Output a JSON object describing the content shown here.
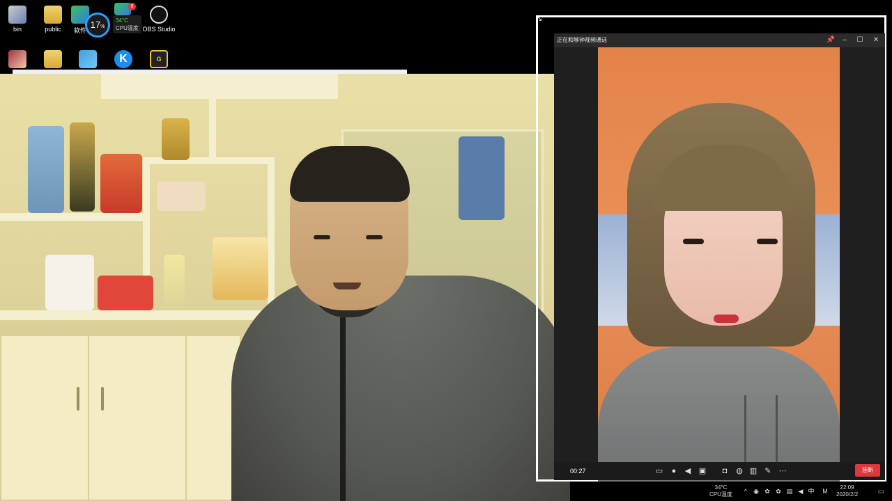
{
  "desktop": {
    "icons": [
      {
        "label": "bin",
        "icon": "recycle-bin-icon"
      },
      {
        "label": "public",
        "icon": "folder-icon"
      },
      {
        "label": "软件",
        "icon": "software-icon"
      },
      {
        "label": "OBS Studio",
        "icon": "obs-icon"
      }
    ],
    "row2_icons": [
      "game-avatar-icon",
      "folder-icon",
      "bird-app-icon",
      "kugou-icon",
      "g-app-icon"
    ],
    "cpu_widget": {
      "usage": "17",
      "usage_unit": "%",
      "temp": "34°C",
      "label": "CPU温度"
    },
    "badge": "8"
  },
  "call": {
    "title": "正在和够钟视频通话",
    "timer": "00:27",
    "hangup_label": "挂断",
    "controls": [
      "chat-icon",
      "mic-icon",
      "speaker-icon",
      "camera-icon",
      "snapshot-icon",
      "record-icon",
      "layout-icon",
      "edit-icon",
      "more-icon"
    ]
  },
  "taskbar": {
    "cpu_temp": "34°C",
    "cpu_label": "CPU温度",
    "ime": "中",
    "ime_mode": "M",
    "time": "22:09",
    "date": "2020/2/2"
  },
  "colors": {
    "accent_blue": "#2aa0ff",
    "hangup_red": "#e0373d",
    "window_bg": "#1f1f1f"
  }
}
